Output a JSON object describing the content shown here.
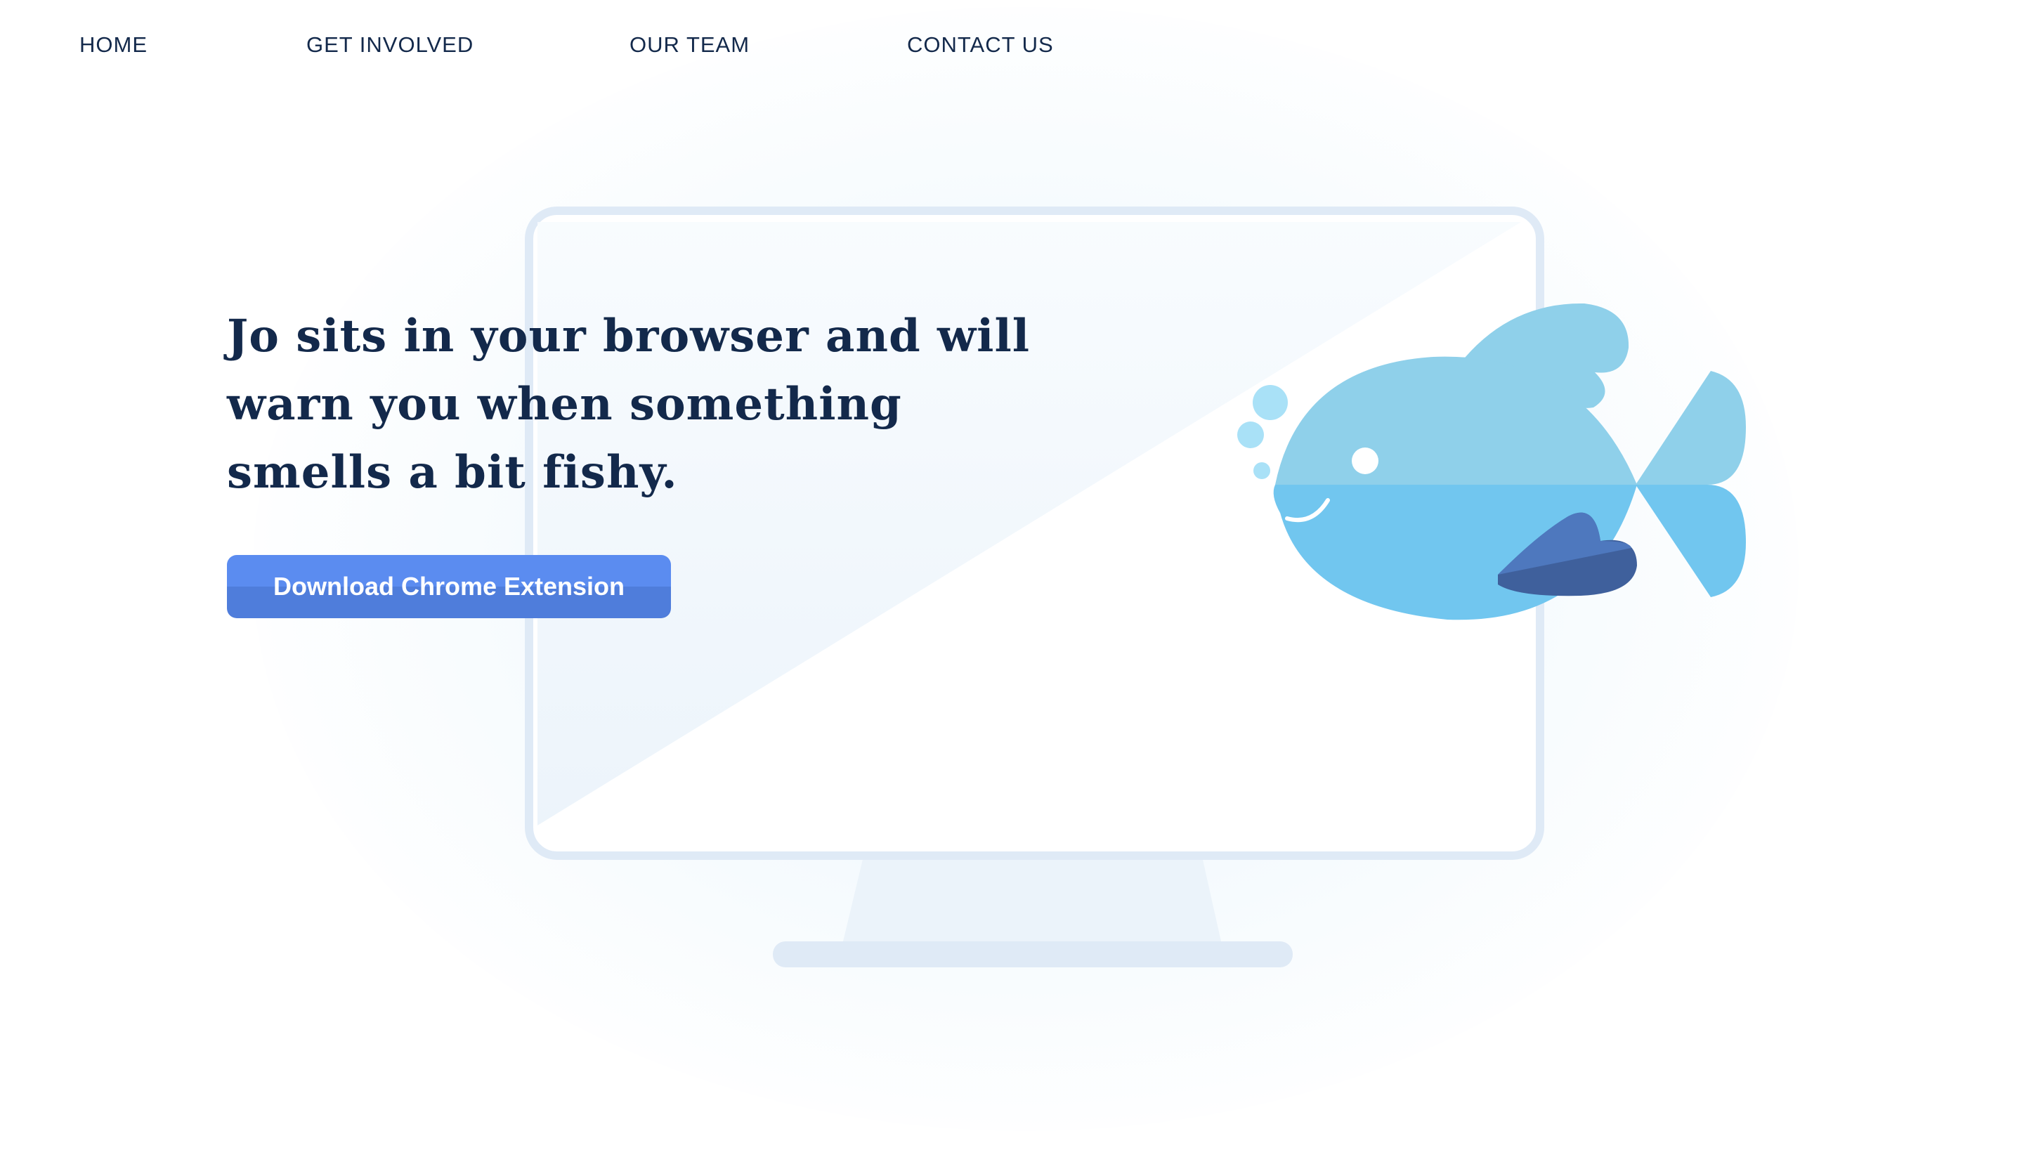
{
  "nav": {
    "items": [
      {
        "label": "HOME"
      },
      {
        "label": "GET INVOLVED"
      },
      {
        "label": "OUR TEAM"
      },
      {
        "label": "CONTACT US"
      }
    ]
  },
  "hero": {
    "line1": "Jo sits in your browser and will",
    "line2": "warn you when something",
    "line3": "smells a bit fishy.",
    "cta_label": "Download Chrome Extension"
  },
  "colors": {
    "navy": "#13294b",
    "button_top": "#5b8cf0",
    "button_bottom": "#4f7ddb",
    "fish_light": "#8fd0ea",
    "fish_mid": "#71c6ef",
    "fin_dark": "#3f609c",
    "monitor_frame": "#dfeaf6"
  },
  "illustration": {
    "icons": [
      "monitor-icon",
      "fish-mascot-icon",
      "bubbles-icon"
    ]
  }
}
